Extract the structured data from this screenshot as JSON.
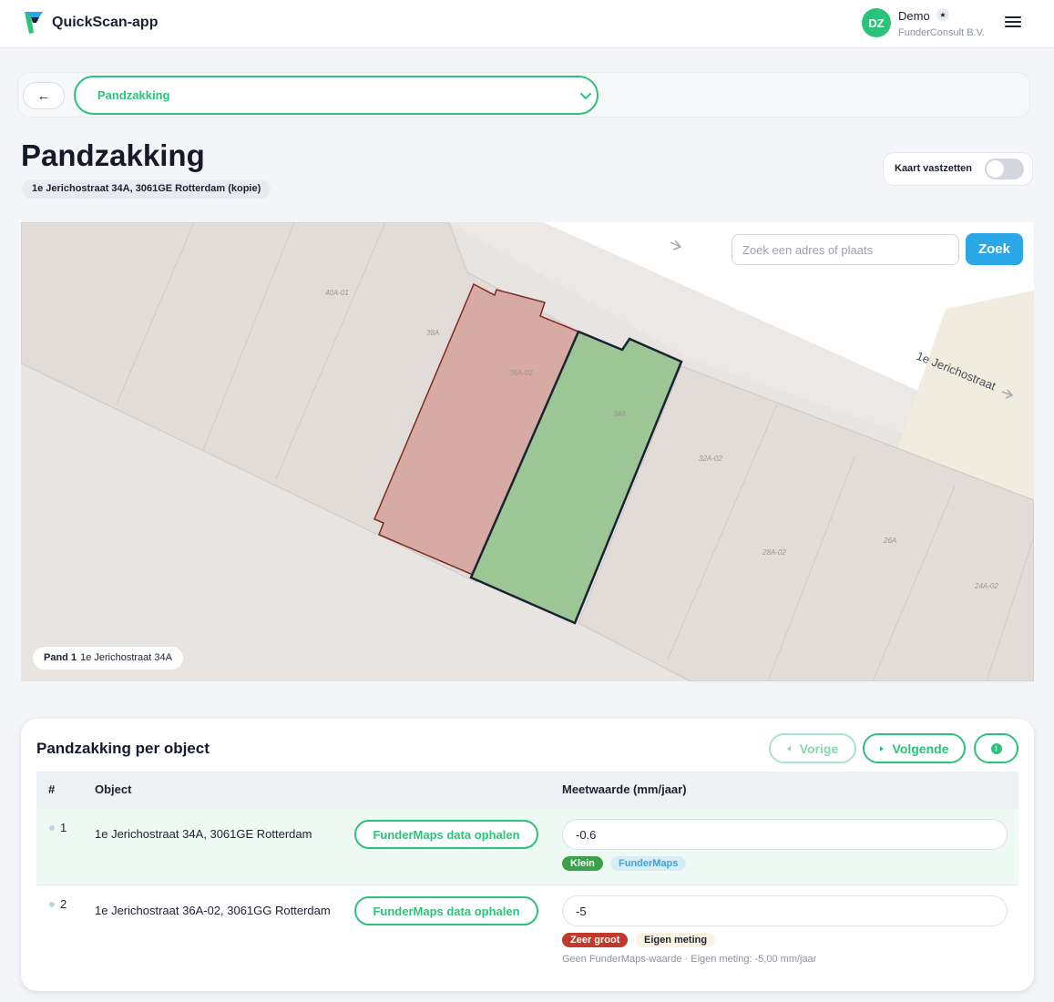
{
  "app": {
    "brand": "QuickScan-app"
  },
  "user": {
    "initials": "DZ",
    "name": "Demo",
    "badge": "★",
    "org": "FunderConsult B.V."
  },
  "nav": {
    "back_label": "←",
    "select_value": "Pandzakking"
  },
  "page": {
    "title": "Pandzakking",
    "address": "1e Jerichostraat 34A, 3061GE Rotterdam (kopie)",
    "lock_label": "Kaart vastzetten",
    "lock_on": false
  },
  "map": {
    "search_placeholder": "Zoek een adres of plaats",
    "search_button": "Zoek",
    "street_name": "1e Jerichostraat",
    "labels": [
      "40A-01",
      "38A",
      "36A-02",
      "34A",
      "32A-02",
      "28A-02",
      "26A",
      "24A-02"
    ],
    "chip_bold": "Pand 1",
    "chip_text": "1e Jerichostraat 34A",
    "colors": {
      "selected": "#9cc795",
      "neighbor": "#d7aaa3",
      "selected_stroke": "#1b2236",
      "neighbor_stroke": "#7d2a22"
    }
  },
  "table": {
    "title": "Pandzakking per object",
    "prev_label": "Vorige",
    "next_label": "Volgende",
    "info_icon": "i",
    "headers": {
      "num": "#",
      "object": "Object",
      "value": "Meetwaarde (mm/jaar)"
    },
    "rows": [
      {
        "num": "1",
        "address": "1e Jerichostraat 34A, 3061GE Rotterdam",
        "button": "FunderMaps data ophalen",
        "value": "-0.6",
        "tag1": "Klein",
        "tag2": "FunderMaps",
        "note": ""
      },
      {
        "num": "2",
        "address": "1e Jerichostraat 36A-02, 3061GG Rotterdam",
        "button": "FunderMaps data ophalen",
        "value": "-5",
        "tag1": "Zeer groot",
        "tag2": "Eigen meting",
        "note": "Geen FunderMaps-waarde · Eigen meting: -5,00 mm/jaar"
      }
    ]
  }
}
